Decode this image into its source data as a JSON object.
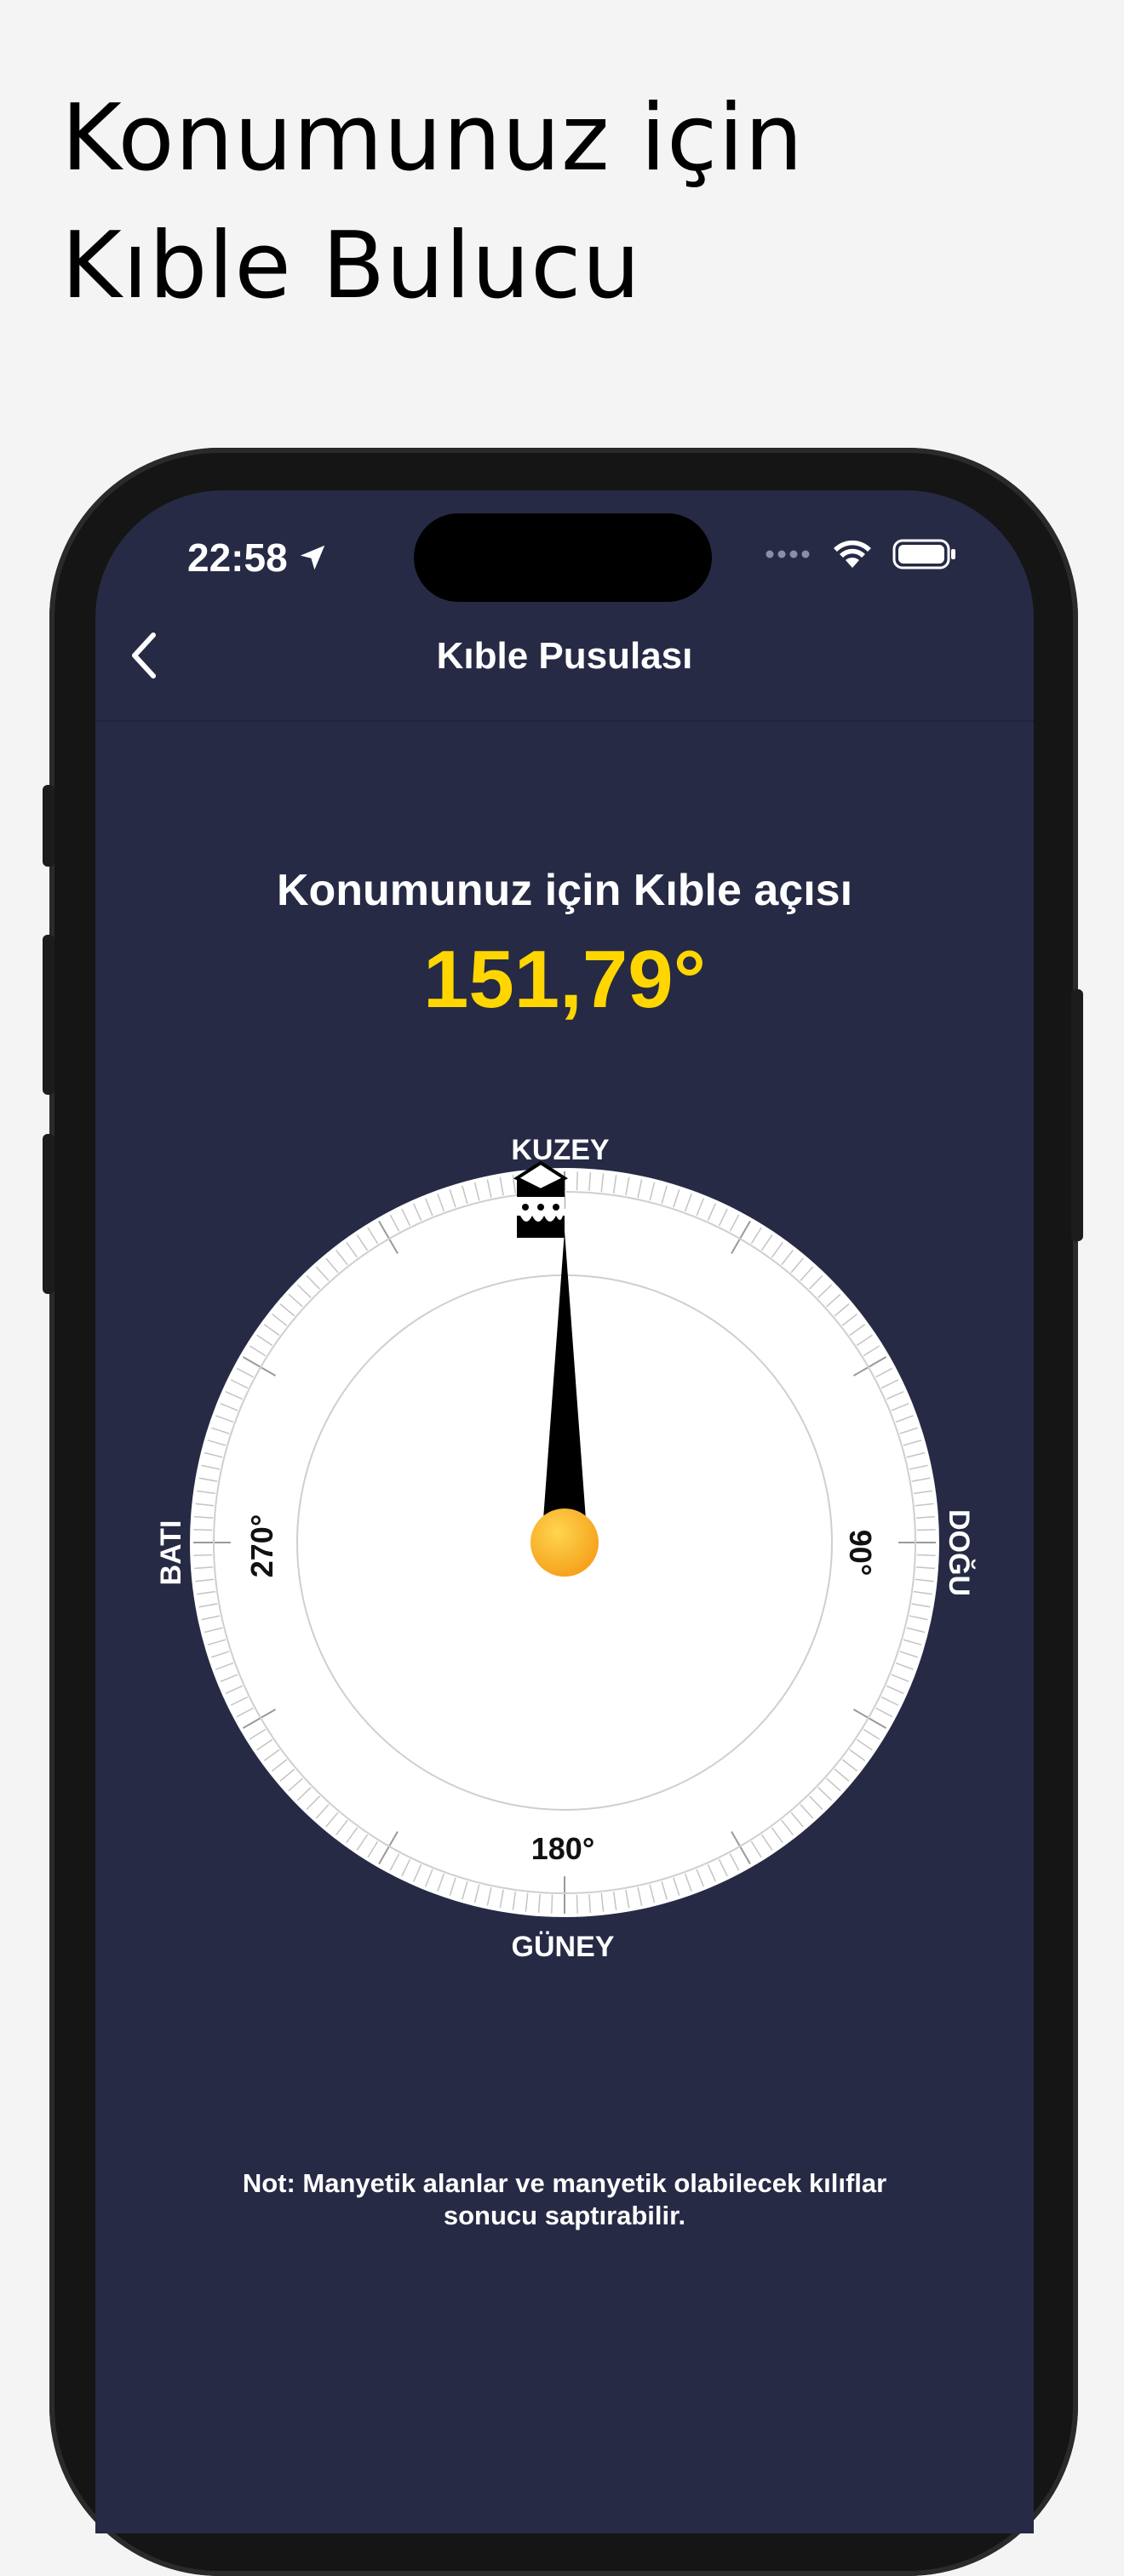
{
  "headline": {
    "line1": "Konumunuz için",
    "line2": "Kıble Bulucu"
  },
  "status_bar": {
    "time": "22:58",
    "icons": [
      "location-arrow-icon",
      "signal-icon",
      "wifi-icon",
      "battery-icon"
    ]
  },
  "nav": {
    "title": "Kıble Pusulası",
    "back_icon": "chevron-left-icon"
  },
  "qibla": {
    "label": "Konumunuz için Kıble açısı",
    "angle_text": "151,79°",
    "angle_value": 151.79
  },
  "compass": {
    "cardinals": {
      "north": "KUZEY",
      "east": "DOĞU",
      "south": "GÜNEY",
      "west": "BATI"
    },
    "degrees": {
      "east": "90°",
      "south": "180°",
      "west": "270°"
    },
    "kaaba_icon": "kaaba-icon"
  },
  "note": "Not: Manyetik alanlar ve manyetik olabilecek kılıflar sonucu saptırabilir.",
  "colors": {
    "screen_bg": "#262a45",
    "angle": "#ffd600",
    "needle": "#000000",
    "hub": "#f9a825",
    "page_bg": "#f4f4f4"
  }
}
